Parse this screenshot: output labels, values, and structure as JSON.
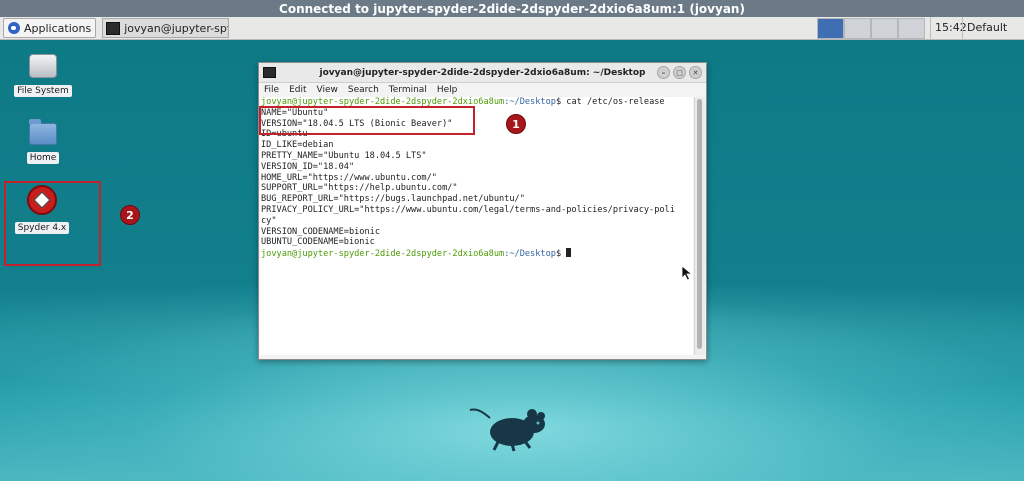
{
  "vnc": {
    "title": "Connected to jupyter-spyder-2dide-2dspyder-2dxio6a8um:1 (jovyan)"
  },
  "panel": {
    "applications_label": "Applications",
    "task_label": "jovyan@jupyter-spyder...",
    "clock": "15:42",
    "user": "Default user"
  },
  "desktop": {
    "icons": [
      {
        "label": "File System",
        "icon": "drive-icon"
      },
      {
        "label": "Home",
        "icon": "folder-icon"
      },
      {
        "label": "Spyder 4.x",
        "icon": "spyder-icon"
      }
    ],
    "markers": [
      "1",
      "2"
    ]
  },
  "terminal": {
    "title": "jovyan@jupyter-spyder-2dide-2dspyder-2dxio6a8um: ~/Desktop",
    "menu": [
      "File",
      "Edit",
      "View",
      "Search",
      "Terminal",
      "Help"
    ],
    "prompt_user": "jovyan@jupyter-spyder-2dide-2dspyder-2dxio6a8um",
    "prompt_path": ":~/Desktop",
    "prompt_symbol": "$ ",
    "command": "cat /etc/os-release",
    "output": [
      "NAME=\"Ubuntu\"",
      "VERSION=\"18.04.5 LTS (Bionic Beaver)\"",
      "ID=ubuntu",
      "ID_LIKE=debian",
      "PRETTY_NAME=\"Ubuntu 18.04.5 LTS\"",
      "VERSION_ID=\"18.04\"",
      "HOME_URL=\"https://www.ubuntu.com/\"",
      "SUPPORT_URL=\"https://help.ubuntu.com/\"",
      "BUG_REPORT_URL=\"https://bugs.launchpad.net/ubuntu/\"",
      "PRIVACY_POLICY_URL=\"https://www.ubuntu.com/legal/terms-and-policies/privacy-poli",
      "cy\"",
      "VERSION_CODENAME=bionic",
      "UBUNTU_CODENAME=bionic"
    ]
  },
  "colors": {
    "desktop": "#0f7c87",
    "prompt_user": "#4e9a06",
    "prompt_path": "#3465a4",
    "annotation": "#c4222a"
  }
}
